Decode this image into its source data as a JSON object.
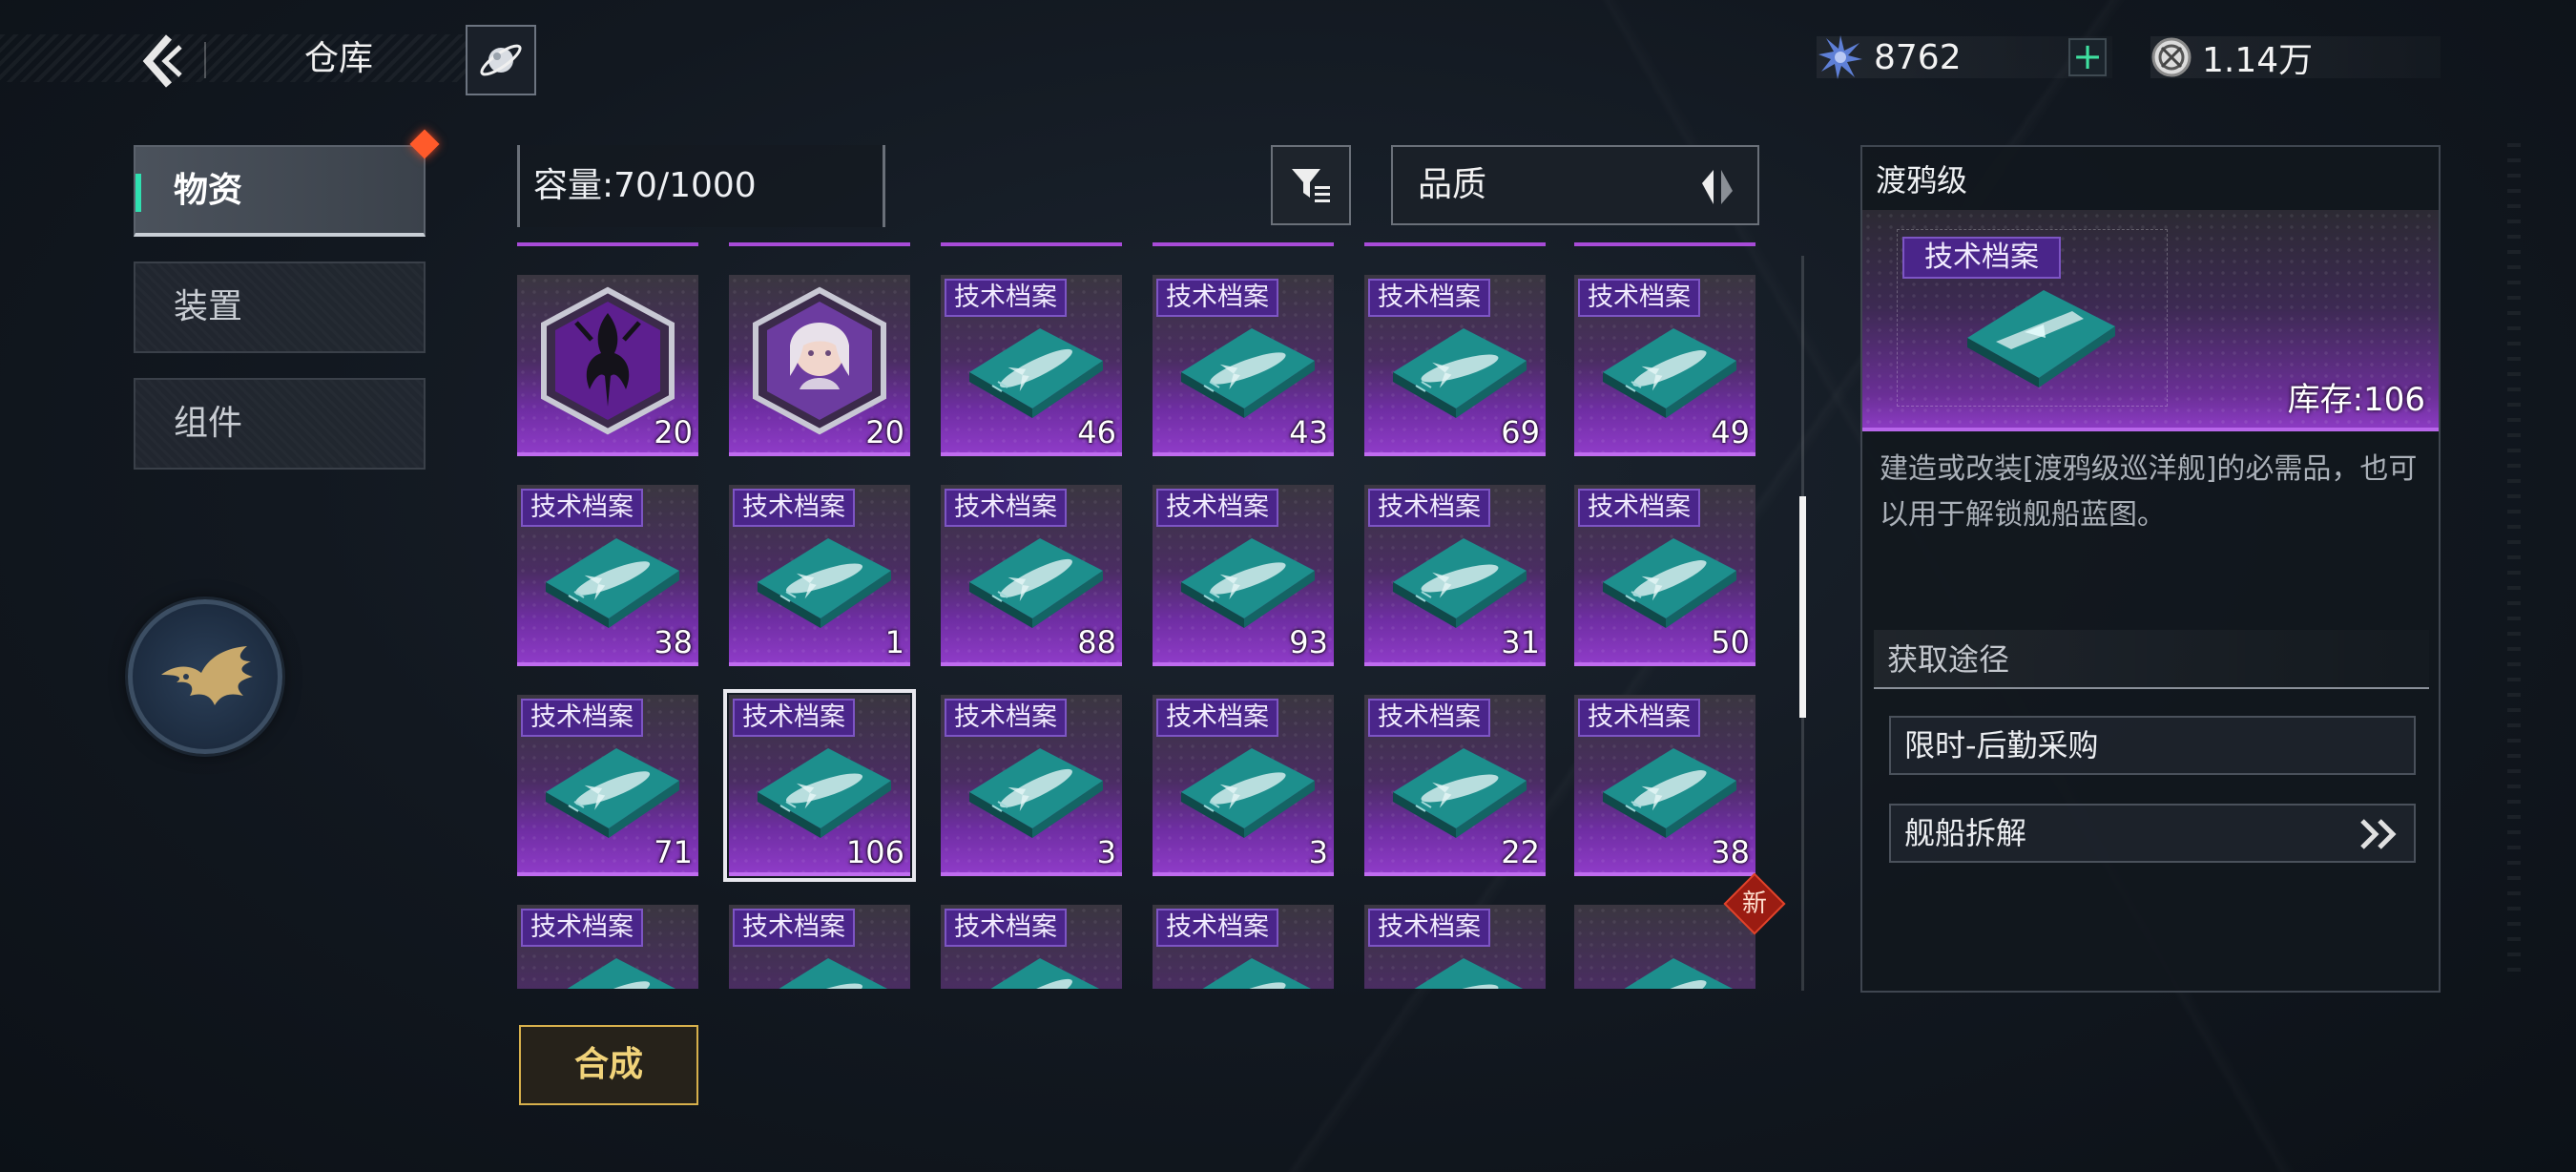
{
  "header": {
    "title": "仓库",
    "back_icon": "back-chevron-icon",
    "planet_icon": "planet-icon"
  },
  "currencies": [
    {
      "icon": "crystal-icon",
      "value": "8762",
      "has_add": true,
      "add_label": "+"
    },
    {
      "icon": "coin-icon",
      "value": "1.14万"
    }
  ],
  "nav": {
    "items": [
      {
        "label": "物资",
        "active": true,
        "badge": true
      },
      {
        "label": "装置",
        "active": false
      },
      {
        "label": "组件",
        "active": false
      }
    ]
  },
  "inventory": {
    "capacity": "容量:70/1000",
    "sort_label": "品质",
    "items": [
      {
        "type": "hex",
        "art": "dark-insignia",
        "count": "20"
      },
      {
        "type": "hex",
        "art": "character-portrait",
        "count": "20"
      },
      {
        "type": "blueprint",
        "tag": "技术档案",
        "count": "46"
      },
      {
        "type": "blueprint",
        "tag": "技术档案",
        "count": "43"
      },
      {
        "type": "blueprint",
        "tag": "技术档案",
        "count": "69"
      },
      {
        "type": "blueprint",
        "tag": "技术档案",
        "count": "49"
      },
      {
        "type": "blueprint",
        "tag": "技术档案",
        "count": "38"
      },
      {
        "type": "blueprint",
        "tag": "技术档案",
        "count": "1"
      },
      {
        "type": "blueprint",
        "tag": "技术档案",
        "count": "88"
      },
      {
        "type": "blueprint",
        "tag": "技术档案",
        "count": "93"
      },
      {
        "type": "blueprint",
        "tag": "技术档案",
        "count": "31"
      },
      {
        "type": "blueprint",
        "tag": "技术档案",
        "count": "50"
      },
      {
        "type": "blueprint",
        "tag": "技术档案",
        "count": "71"
      },
      {
        "type": "blueprint",
        "tag": "技术档案",
        "count": "106",
        "selected": true
      },
      {
        "type": "blueprint",
        "tag": "技术档案",
        "count": "3"
      },
      {
        "type": "blueprint",
        "tag": "技术档案",
        "count": "3"
      },
      {
        "type": "blueprint",
        "tag": "技术档案",
        "count": "22"
      },
      {
        "type": "blueprint",
        "tag": "技术档案",
        "count": "38"
      },
      {
        "type": "blueprint",
        "tag": "技术档案",
        "count": ""
      },
      {
        "type": "blueprint",
        "tag": "技术档案",
        "count": ""
      },
      {
        "type": "blueprint",
        "tag": "技术档案",
        "count": ""
      },
      {
        "type": "blueprint",
        "tag": "技术档案",
        "count": ""
      },
      {
        "type": "blueprint",
        "tag": "技术档案",
        "count": ""
      },
      {
        "type": "blueprint",
        "tag": "",
        "count": "",
        "is_new": true
      }
    ],
    "new_badge": "新",
    "synthesize_label": "合成"
  },
  "detail": {
    "name": "渡鸦级",
    "tag": "技术档案",
    "stock": "库存:106",
    "description": "建造或改装[渡鸦级巡洋舰]的必需品，也可以用于解锁舰船蓝图。",
    "source_header": "获取途径",
    "sources": [
      {
        "label": "限时-后勤采购",
        "has_arrow": false
      },
      {
        "label": "舰船拆解",
        "has_arrow": true
      }
    ]
  },
  "colors": {
    "rarity_purple": "#8e3bc7",
    "tag_purple": "#4a258a",
    "accent_teal": "#2fe0b0",
    "synth_gold": "#d7b04c",
    "new_red": "#9b1c12"
  }
}
